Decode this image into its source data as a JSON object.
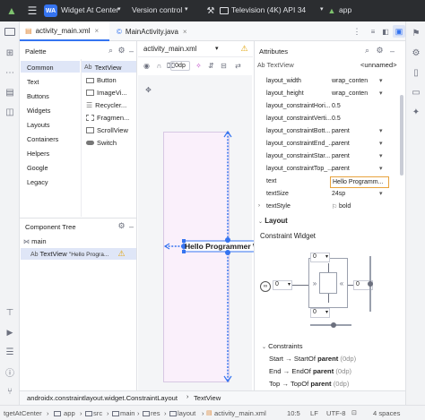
{
  "titlebar": {
    "project_badge": "WA",
    "project": "Widget At Center",
    "vcs": "Version control",
    "device": "Television (4K) API 34",
    "run_config": "app"
  },
  "tabs": [
    {
      "label": "activity_main.xml"
    },
    {
      "label": "MainActivity.java"
    }
  ],
  "palette": {
    "title": "Palette",
    "categories": [
      "Common",
      "Text",
      "Buttons",
      "Widgets",
      "Layouts",
      "Containers",
      "Helpers",
      "Google",
      "Legacy"
    ],
    "items": [
      {
        "prefix": "Ab",
        "label": "TextView"
      },
      {
        "label": "Button"
      },
      {
        "label": "ImageVi..."
      },
      {
        "label": "Recycler..."
      },
      {
        "label": "Fragmen..."
      },
      {
        "label": "ScrollView"
      },
      {
        "label": "Switch"
      }
    ]
  },
  "tree": {
    "title": "Component Tree",
    "root": "main",
    "child_prefix": "Ab",
    "child": "TextView",
    "child_text": "\"Hello Progra...",
    "warning": "warning"
  },
  "design_toolbar": {
    "file": "activity_main.xml",
    "margin": "0dp"
  },
  "canvas": {
    "textview_text": "Hello Programmer W"
  },
  "attributes": {
    "title": "Attributes",
    "component_prefix": "Ab",
    "component": "TextView",
    "component_id": "<unnamed>",
    "rows": [
      {
        "key": "layout_width",
        "value": "wrap_conten",
        "dropdown": true
      },
      {
        "key": "layout_height",
        "value": "wrap_conten",
        "dropdown": true
      },
      {
        "key": "layout_constraintHori...",
        "value": "0.5",
        "dropdown": false
      },
      {
        "key": "layout_constraintVerti...",
        "value": "0.5",
        "dropdown": false
      },
      {
        "key": "layout_constraintBott...",
        "value": "parent",
        "dropdown": true
      },
      {
        "key": "layout_constraintEnd_...",
        "value": "parent",
        "dropdown": true
      },
      {
        "key": "layout_constraintStar...",
        "value": "parent",
        "dropdown": true
      },
      {
        "key": "layout_constraintTop_...",
        "value": "parent",
        "dropdown": true
      },
      {
        "key": "text",
        "value": "Hello Programm...",
        "dropdown": false
      },
      {
        "key": "textSize",
        "value": "24sp",
        "dropdown": true
      },
      {
        "key": "textStyle",
        "value": "bold",
        "dropdown": false
      }
    ],
    "layout_section": "Layout",
    "constraint_widget": "Constraint Widget",
    "margins": {
      "top": "0",
      "left": "0",
      "right": "0",
      "bottom": "0"
    },
    "constraints_section": "Constraints",
    "constraints": [
      {
        "from": "Start",
        "to": "StartOf",
        "target": "parent",
        "value": "(0dp)"
      },
      {
        "from": "End",
        "to": "EndOf",
        "target": "parent",
        "value": "(0dp)"
      },
      {
        "from": "Top",
        "to": "TopOf",
        "target": "parent",
        "value": "(0dp)"
      }
    ]
  },
  "breadcrumb": {
    "path": "androidx.constraintlayout.widget.ConstraintLayout",
    "current": "TextView"
  },
  "status": {
    "crumbs": [
      "tgetAtCenter",
      "app",
      "src",
      "main",
      "res",
      "layout",
      "activity_main.xml"
    ],
    "position": "10:5",
    "line_sep": "LF",
    "encoding": "UTF-8",
    "indent": "4 spaces"
  }
}
